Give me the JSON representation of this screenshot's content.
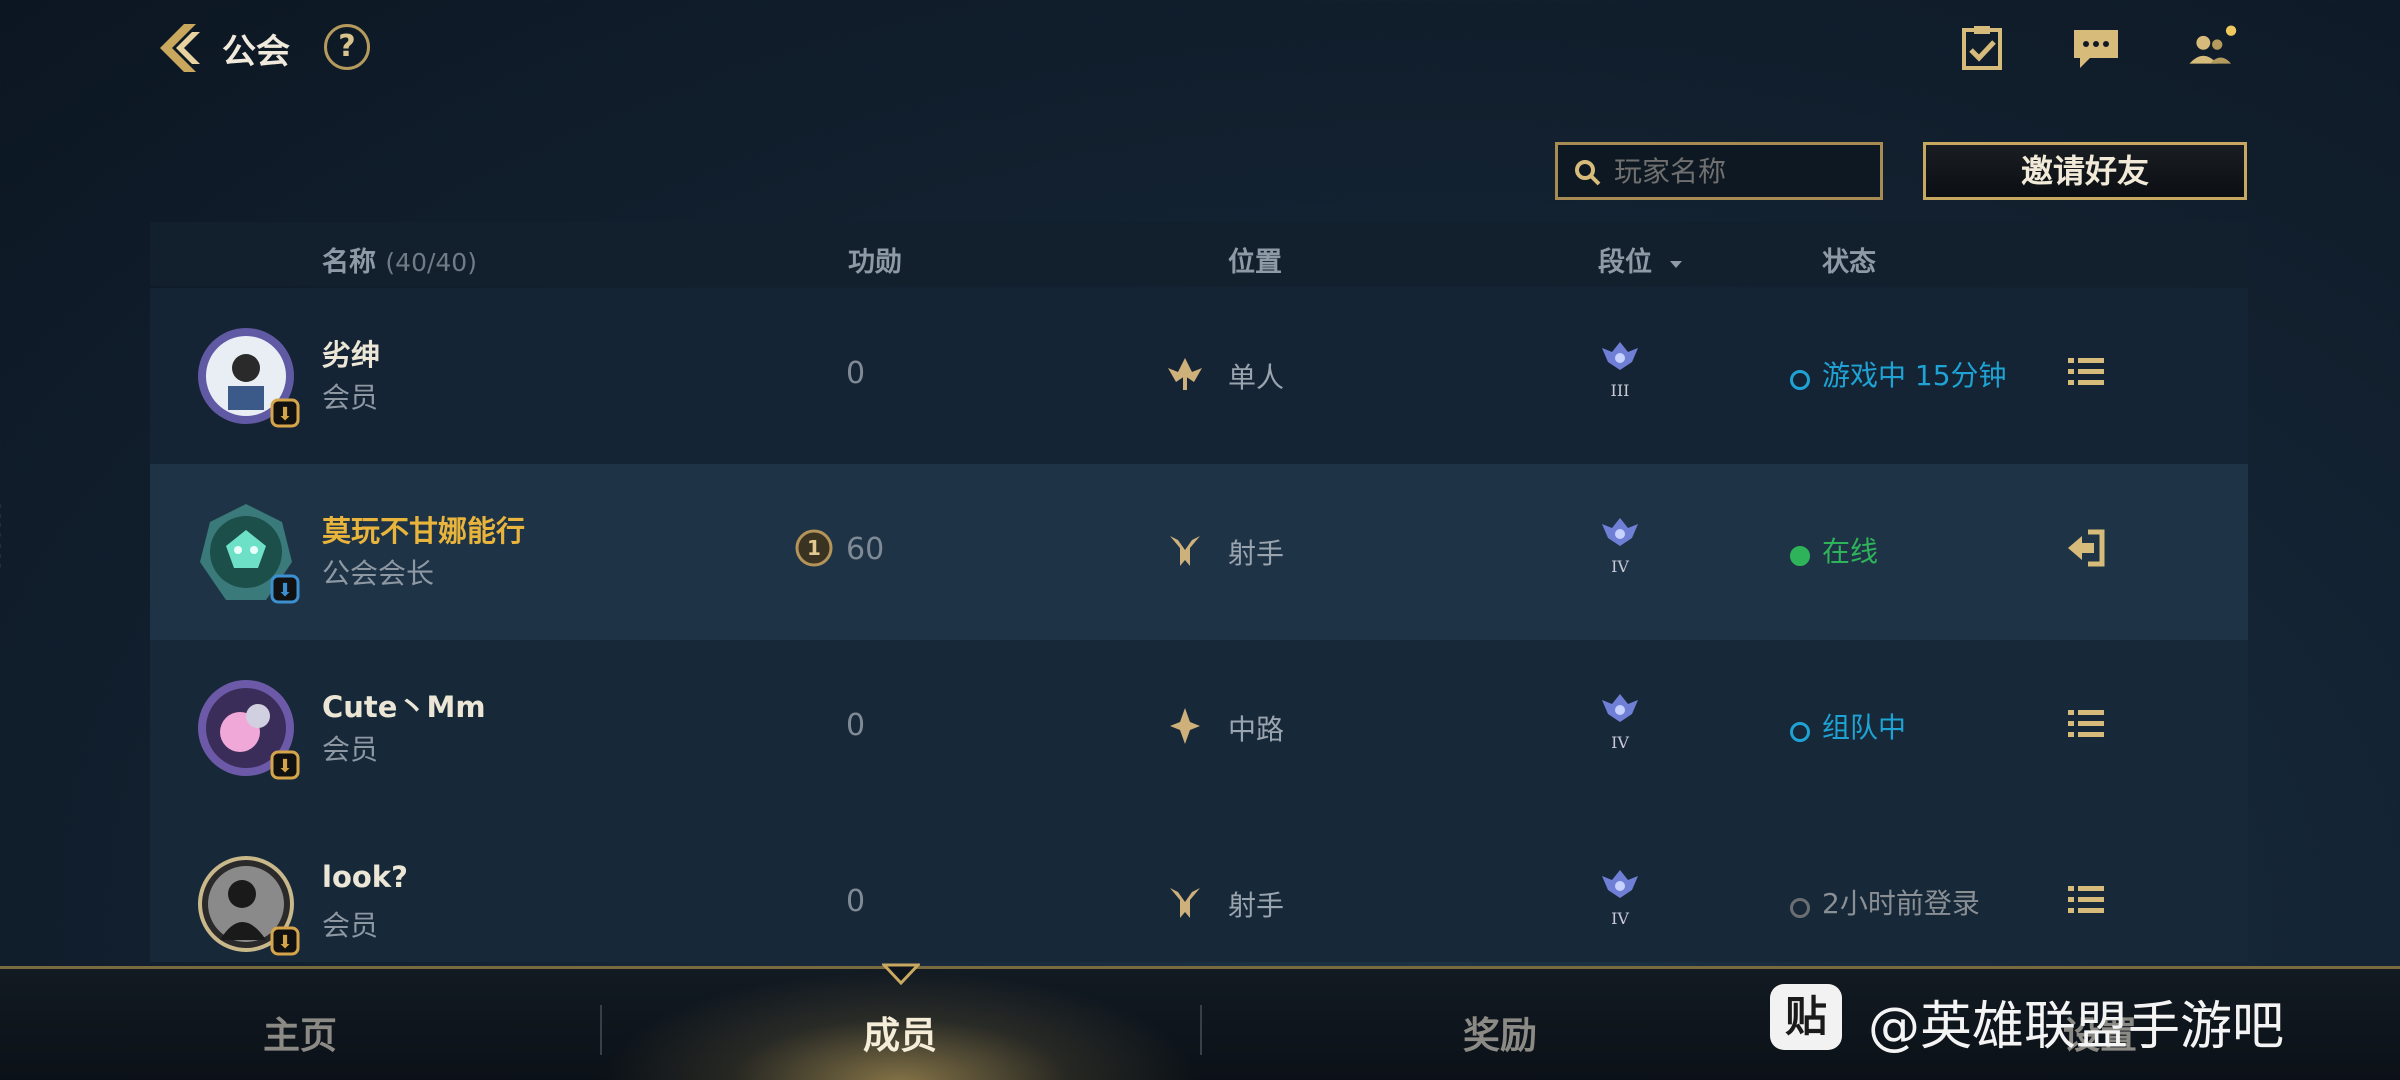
{
  "header": {
    "title": "公会",
    "help_label": "?"
  },
  "toolbar": {
    "search_placeholder": "玩家名称",
    "invite_label": "邀请好友"
  },
  "table": {
    "columns": {
      "name": "名称",
      "name_count": "(40/40)",
      "merit": "功勋",
      "position": "位置",
      "rank": "段位",
      "status": "状态"
    },
    "rows": [
      {
        "name": "劣绅",
        "role": "会员",
        "merit": "0",
        "position": "单人",
        "rank_tier": "III",
        "status": "游戏中 15分钟",
        "status_color": "#1ea3d4",
        "action": "menu"
      },
      {
        "name": "莫玩不甘娜能行",
        "role": "公会会长",
        "merit": "60",
        "merit_badge": "1",
        "position": "射手",
        "rank_tier": "IV",
        "status": "在线",
        "status_color": "#2fb35a",
        "action": "leave"
      },
      {
        "name": "Cute丶Mm",
        "role": "会员",
        "merit": "0",
        "position": "中路",
        "rank_tier": "IV",
        "status": "组队中",
        "status_color": "#1ea3d4",
        "action": "menu"
      },
      {
        "name": "look?",
        "role": "会员",
        "merit": "0",
        "position": "射手",
        "rank_tier": "IV",
        "status": "2小时前登录",
        "status_color": "#6b6f73",
        "action": "menu"
      }
    ]
  },
  "tabs": [
    {
      "label": "主页"
    },
    {
      "label": "成员",
      "active": true
    },
    {
      "label": "奖励"
    },
    {
      "label": "设置"
    }
  ],
  "watermark": {
    "icon_text": "贴",
    "text": "@英雄联盟手游吧"
  },
  "side_code": "6632883"
}
